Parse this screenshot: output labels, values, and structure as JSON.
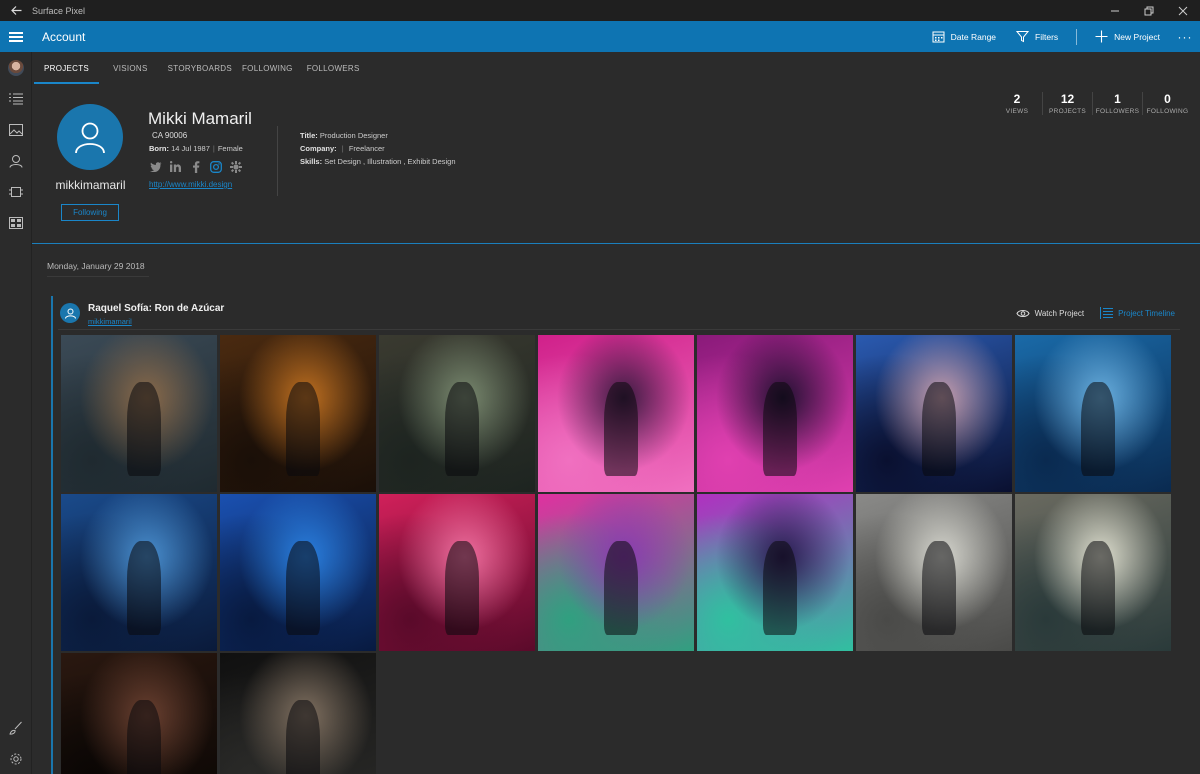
{
  "window": {
    "title": "Surface Pixel"
  },
  "command_bar": {
    "title": "Account",
    "date_range_label": "Date Range",
    "filters_label": "Filters",
    "new_project_label": "New Project",
    "more_label": "···"
  },
  "tabs": [
    {
      "label": "PROJECTS",
      "active": true
    },
    {
      "label": "VISIONS"
    },
    {
      "label": "STORYBOARDS"
    },
    {
      "label": "FOLLOWING"
    },
    {
      "label": "FOLLOWERS"
    }
  ],
  "profile": {
    "display_name": "Mikki Mamaril",
    "username": "mikkimamaril",
    "location": "CA 90006",
    "born_label": "Born:",
    "born_date": "14 Jul 1987",
    "gender": "Female",
    "url": "http://www.mikki.design",
    "follow_label": "Following",
    "title_label": "Title:",
    "title_value": "Production Designer",
    "company_label": "Company:",
    "company_value": "Freelancer",
    "skills_label": "Skills:",
    "skills_value": "Set Design ,  Illustration ,  Exhibit Design",
    "socials": [
      "twitter-icon",
      "linkedin-icon",
      "facebook-icon",
      "instagram-icon",
      "settings-icon"
    ]
  },
  "stats": [
    {
      "value": "2",
      "label": "VIEWS"
    },
    {
      "value": "12",
      "label": "PROJECTS"
    },
    {
      "value": "1",
      "label": "FOLLOWERS"
    },
    {
      "value": "0",
      "label": "FOLLOWING"
    }
  ],
  "feed": {
    "date": "Monday, January 29 2018",
    "project": {
      "title": "Raquel Sofía: Ron de Azúcar",
      "user": "mikkimamaril",
      "watch_label": "Watch Project",
      "timeline_label": "Project Timeline"
    },
    "photos": [
      {
        "palette": [
          "#3b4a56",
          "#8a6a4a",
          "#1f2a30"
        ]
      },
      {
        "palette": [
          "#4a2a10",
          "#c07020",
          "#1a0f08"
        ]
      },
      {
        "palette": [
          "#3a3a30",
          "#7a8a70",
          "#1d2420"
        ]
      },
      {
        "palette": [
          "#d0208a",
          "#3a1a40",
          "#f070c0"
        ]
      },
      {
        "palette": [
          "#8a1a7a",
          "#201030",
          "#e040b0"
        ]
      },
      {
        "palette": [
          "#2a5ab0",
          "#c8a0b0",
          "#0a1030"
        ]
      },
      {
        "palette": [
          "#1a6aa8",
          "#6ab0e0",
          "#0a2a50"
        ]
      },
      {
        "palette": [
          "#1a4a8a",
          "#4a90d0",
          "#0a1a3a"
        ]
      },
      {
        "palette": [
          "#1a50b0",
          "#2a80e0",
          "#081a40"
        ]
      },
      {
        "palette": [
          "#d0205a",
          "#f070a0",
          "#5a0a2a"
        ]
      },
      {
        "palette": [
          "#e030a0",
          "#8a3ab0",
          "#30a080"
        ]
      },
      {
        "palette": [
          "#b030c0",
          "#2a1a50",
          "#30c0a0"
        ]
      },
      {
        "palette": [
          "#8a8a88",
          "#d8d8d0",
          "#4a4a48"
        ]
      },
      {
        "palette": [
          "#6a6a60",
          "#e0e0d0",
          "#2a3a3a"
        ]
      },
      {
        "palette": [
          "#2a1810",
          "#6a4030",
          "#0a0604"
        ]
      },
      {
        "palette": [
          "#101010",
          "#807060",
          "#2a2a28"
        ]
      }
    ]
  }
}
